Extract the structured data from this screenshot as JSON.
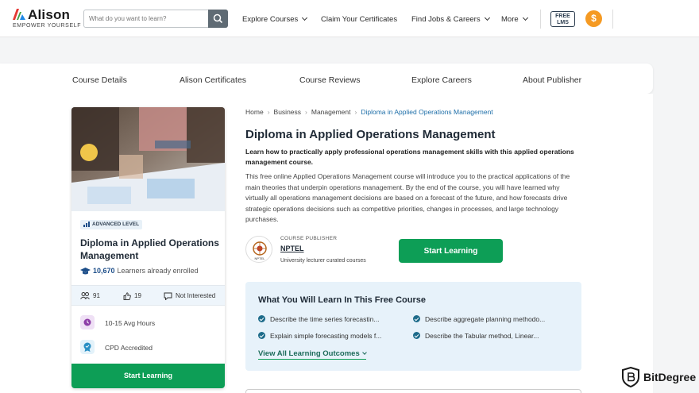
{
  "brand": {
    "name": "Alison",
    "tagline": "EMPOWER YOURSELF"
  },
  "search": {
    "placeholder": "What do you want to learn?"
  },
  "nav": {
    "items": [
      {
        "label": "Explore Courses",
        "dropdown": true
      },
      {
        "label": "Claim Your Certificates",
        "dropdown": false
      },
      {
        "label": "Find Jobs & Careers",
        "dropdown": true
      },
      {
        "label": "More",
        "dropdown": true
      }
    ],
    "free_lms_line1": "FREE",
    "free_lms_line2": "LMS",
    "coin_symbol": "$"
  },
  "tabs": [
    "Course Details",
    "Alison Certificates",
    "Course Reviews",
    "Explore Careers",
    "About Publisher"
  ],
  "card": {
    "level": "ADVANCED LEVEL",
    "title": "Diploma in Applied Operations Management",
    "learners_count": "10,670",
    "learners_label": "Learners already enrolled",
    "likes": "91",
    "thumbs": "19",
    "not_interested": "Not Interested",
    "hours": "10-15 Avg Hours",
    "accreditation": "CPD Accredited",
    "cta": "Start Learning"
  },
  "breadcrumb": [
    "Home",
    "Business",
    "Management",
    "Diploma in Applied Operations Management"
  ],
  "course": {
    "title": "Diploma in Applied Operations Management",
    "lead": "Learn how to practically apply professional operations management skills with this applied operations management course.",
    "description": "This free online Applied Operations Management course will introduce you to the practical applications of the main theories that underpin operations management. By the end of the course, you will have learned why virtually all operations management decisions are based on a forecast of the future, and how forecasts drive strategic operations decisions such as competitive priorities, changes in processes, and large technology purchases."
  },
  "publisher": {
    "label": "COURSE PUBLISHER",
    "name": "NPTEL",
    "subtitle": "University lecturer curated courses",
    "logo_text": "NPTEL"
  },
  "start_button": "Start Learning",
  "learn": {
    "title": "What You Will Learn In This Free Course",
    "outcomes": [
      "Describe the time series forecastin...",
      "Describe aggregate planning methodo...",
      "Explain simple forecasting models f...",
      "Describe the Tabular method, Linear..."
    ],
    "view_all": "View All Learning Outcomes"
  },
  "watermark": "BitDegree",
  "colors": {
    "primary_green": "#0d9e56",
    "navy": "#1f2a36",
    "link_blue": "#1d6ea8",
    "coin_orange": "#f59a23",
    "panel_blue": "#e7f2fa"
  }
}
